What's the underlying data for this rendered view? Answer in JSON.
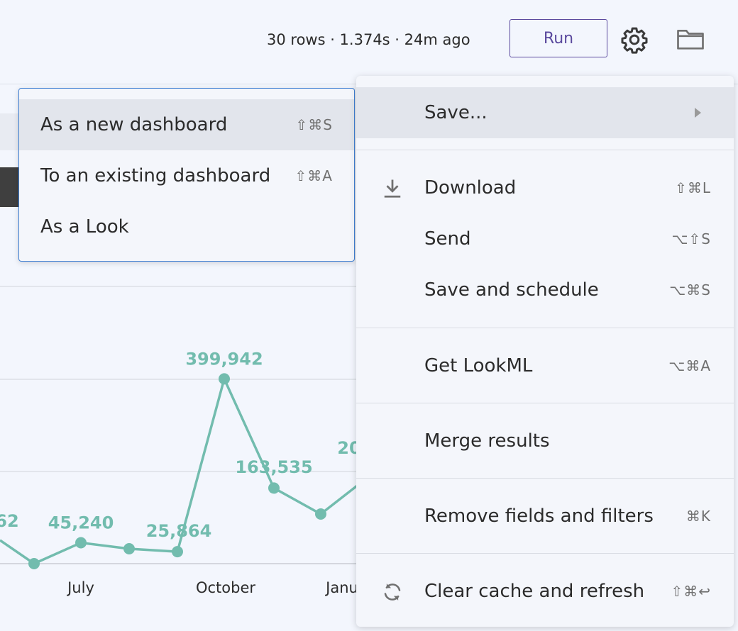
{
  "topbar": {
    "status": "30 rows · 1.374s · 24m ago",
    "run_label": "Run"
  },
  "submenu": {
    "items": [
      {
        "label": "As a new dashboard",
        "shortcut": "⇧⌘S"
      },
      {
        "label": "To an existing dashboard",
        "shortcut": "⇧⌘A"
      },
      {
        "label": "As a Look",
        "shortcut": ""
      }
    ]
  },
  "menu": {
    "save": {
      "label": "Save..."
    },
    "download": {
      "label": "Download",
      "shortcut": "⇧⌘L",
      "icon": "download-icon"
    },
    "send": {
      "label": "Send",
      "shortcut": "⌥⇧S"
    },
    "save_schedule": {
      "label": "Save and schedule",
      "shortcut": "⌥⌘S"
    },
    "get_lookml": {
      "label": "Get LookML",
      "shortcut": "⌥⌘A"
    },
    "merge": {
      "label": "Merge results",
      "shortcut": ""
    },
    "remove_fields": {
      "label": "Remove fields and filters",
      "shortcut": "⌘K"
    },
    "clear_cache": {
      "label": "Clear cache and refresh",
      "shortcut": "⇧⌘↩",
      "icon": "refresh-icon"
    }
  },
  "chart_data": {
    "type": "line",
    "color": "#72bcae",
    "x_tick_labels": [
      "July",
      "October",
      "Janu"
    ],
    "points": [
      {
        "value": null,
        "label": "62"
      },
      {
        "value": 3,
        "label": ""
      },
      {
        "value": 45240,
        "label": "45,240"
      },
      {
        "value": null,
        "label": ""
      },
      {
        "value": 25864,
        "label": "25,864"
      },
      {
        "value": 399942,
        "label": "399,942"
      },
      {
        "value": 163535,
        "label": "163,535"
      },
      {
        "value": null,
        "label": ""
      },
      {
        "value": null,
        "label": "20"
      }
    ]
  }
}
